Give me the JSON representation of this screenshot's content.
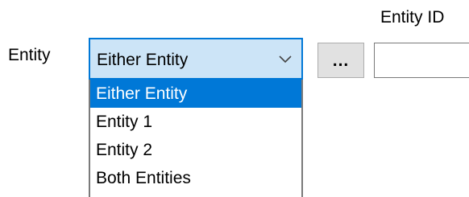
{
  "labels": {
    "entity": "Entity",
    "entity_id": "Entity ID"
  },
  "entity_select": {
    "selected_value": "Either Entity",
    "is_open": true,
    "arrow_icon": "chevron-down-icon",
    "options": [
      {
        "label": "Either Entity",
        "selected": true
      },
      {
        "label": "Entity 1",
        "selected": false
      },
      {
        "label": "Entity 2",
        "selected": false
      },
      {
        "label": "Both Entities",
        "selected": false
      }
    ]
  },
  "browse_button": {
    "label": "..."
  },
  "entity_id_input": {
    "value": "",
    "placeholder": ""
  },
  "colors": {
    "accent": "#0078d7",
    "combo_focus_bg": "#cce4f7",
    "button_bg": "#e1e1e1",
    "border": "#7a7a7a"
  }
}
